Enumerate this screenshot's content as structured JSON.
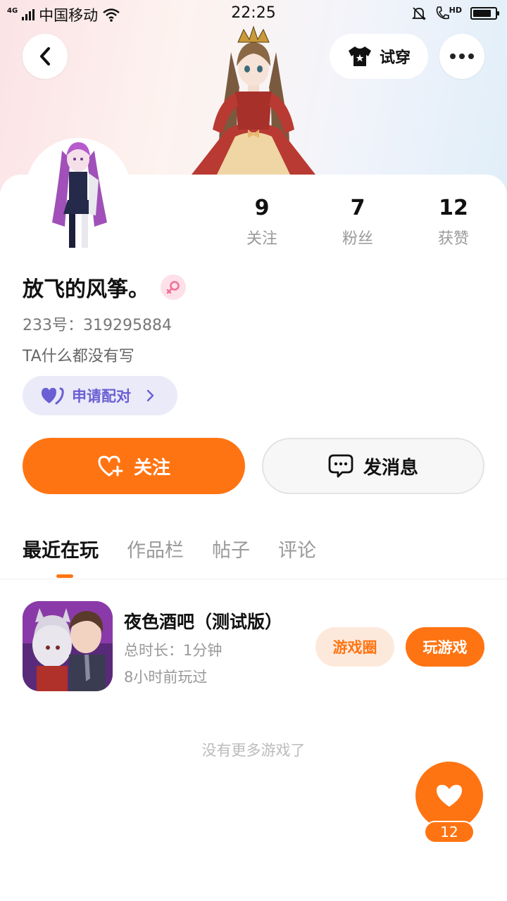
{
  "status_bar": {
    "network": "4G",
    "carrier": "中国移动",
    "time": "22:25",
    "hd": "HD"
  },
  "header": {
    "tryon_label": "试穿"
  },
  "profile": {
    "username": "放飞的风筝。",
    "uid": "233号：319295884",
    "bio": "TA什么都没有写",
    "pair_label": "申请配对",
    "stats": [
      {
        "value": "9",
        "label": "关注"
      },
      {
        "value": "7",
        "label": "粉丝"
      },
      {
        "value": "12",
        "label": "获赞"
      }
    ]
  },
  "actions": {
    "follow_label": "关注",
    "message_label": "发消息"
  },
  "tabs": [
    {
      "label": "最近在玩",
      "active": true
    },
    {
      "label": "作品栏",
      "active": false
    },
    {
      "label": "帖子",
      "active": false
    },
    {
      "label": "评论",
      "active": false
    }
  ],
  "games": [
    {
      "title": "夜色酒吧（测试版）",
      "duration": "总时长：1分钟",
      "last_played": "8小时前玩过",
      "circle_label": "游戏圈",
      "play_label": "玩游戏"
    }
  ],
  "no_more": "没有更多游戏了",
  "like": {
    "count": "12"
  },
  "colors": {
    "accent": "#ff7412",
    "pair_purple": "#6a5fd3",
    "gender_pink": "#f0709a"
  }
}
